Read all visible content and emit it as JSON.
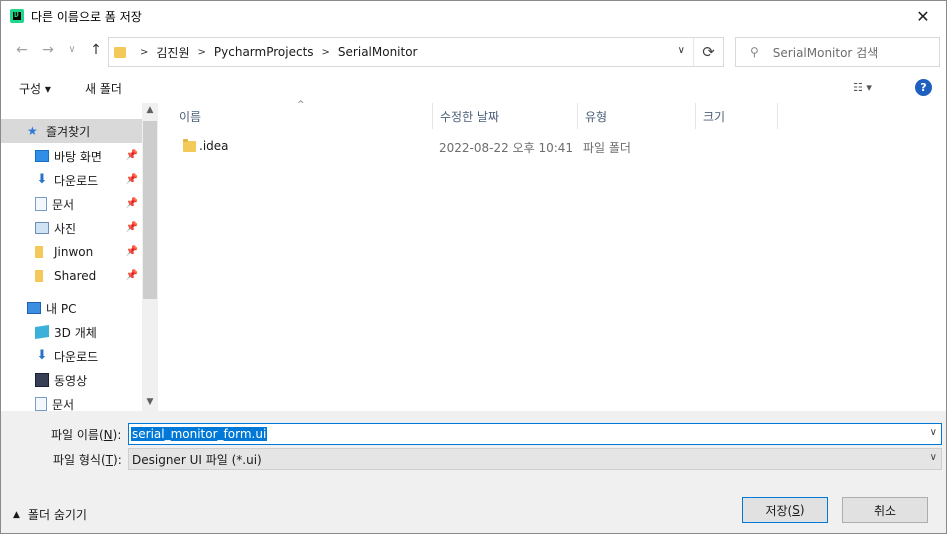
{
  "window": {
    "title": "다른 이름으로 폼 저장",
    "close_label": "✕"
  },
  "nav": {
    "back": "←",
    "forward": "→",
    "dropdown": "∨",
    "up": "↑",
    "breadcrumbs": [
      "김진원",
      "PycharmProjects",
      "SerialMonitor"
    ],
    "search_placeholder": "SerialMonitor 검색",
    "refresh": "⟳"
  },
  "toolbar": {
    "organize_label": "구성 ▾",
    "new_folder_label": "새 폴더",
    "view_label": "☷ ▾",
    "help_label": "?"
  },
  "sidebar": {
    "quick_access": "즐겨찾기",
    "items": [
      {
        "label": "바탕 화면",
        "icon": "desktop-icon",
        "pinned": true
      },
      {
        "label": "다운로드",
        "icon": "download-icon",
        "pinned": true
      },
      {
        "label": "문서",
        "icon": "document-icon",
        "pinned": true
      },
      {
        "label": "사진",
        "icon": "picture-icon",
        "pinned": true
      },
      {
        "label": "Jinwon",
        "icon": "folder-icon",
        "pinned": true
      },
      {
        "label": "Shared",
        "icon": "folder-icon",
        "pinned": true
      }
    ],
    "this_pc": "내 PC",
    "pc_items": [
      {
        "label": "3D 개체",
        "icon": "3d-objects-icon"
      },
      {
        "label": "다운로드",
        "icon": "download-icon"
      },
      {
        "label": "동영상",
        "icon": "video-icon"
      },
      {
        "label": "문서",
        "icon": "document-icon"
      }
    ]
  },
  "file_list": {
    "columns": [
      "이름",
      "수정한 날짜",
      "유형",
      "크기"
    ],
    "rows": [
      {
        "name": ".idea",
        "modified": "2022-08-22 오후 10:41",
        "type": "파일 폴더",
        "size": ""
      }
    ]
  },
  "form": {
    "filename_label_pre": "파일 이름(",
    "filename_label_key": "N",
    "filename_label_post": "):",
    "filename_value": "serial_monitor_form.ui",
    "filetype_label_pre": "파일 형식(",
    "filetype_label_key": "T",
    "filetype_label_post": "):",
    "filetype_value": "Designer UI 파일 (*.ui)",
    "hide_folders_label": "폴더 숨기기",
    "save_pre": "저장(",
    "save_key": "S",
    "save_post": ")",
    "cancel_label": "취소"
  },
  "colors": {
    "accent": "#0078d7",
    "folder": "#f3c95a",
    "selected_bg": "#d9d9d9",
    "header_text": "#4c607a"
  }
}
